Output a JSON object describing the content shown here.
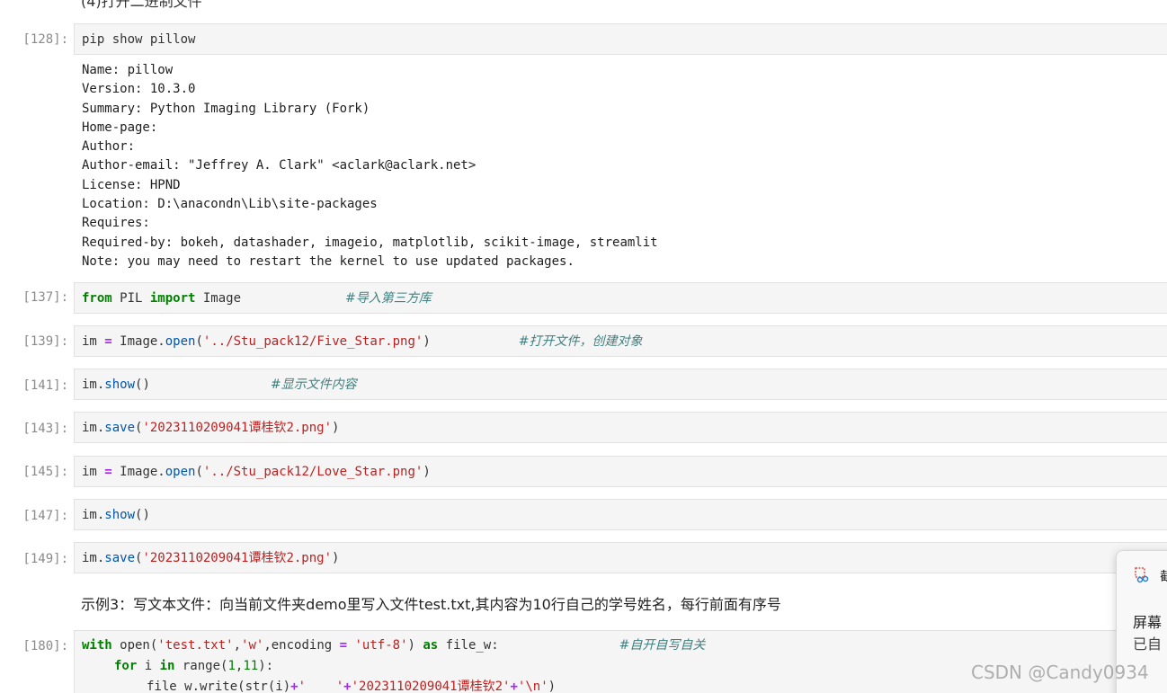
{
  "top_heading": "(4)打开二进制文件",
  "cells": [
    {
      "prompt": "[128]:",
      "code": "pip show pillow"
    },
    {
      "prompt": "[137]:",
      "code_parts": {
        "kw1": "from",
        "mod": " PIL ",
        "kw2": "import",
        "name": " Image",
        "comment": "#导入第三方库"
      }
    },
    {
      "prompt": "[139]:",
      "code_parts": {
        "a": "im ",
        "op": "=",
        "b": " Image.",
        "fn": "open",
        "c": "(",
        "str": "'../Stu_pack12/Five_Star.png'",
        "d": ")",
        "comment": "#打开文件，创建对象"
      }
    },
    {
      "prompt": "[141]:",
      "code_parts": {
        "a": "im.",
        "fn": "show",
        "b": "()",
        "comment": "#显示文件内容"
      }
    },
    {
      "prompt": "[143]:",
      "code_parts": {
        "a": "im.",
        "fn": "save",
        "b": "(",
        "str": "'2023110209041谭桂钦2.png'",
        "c": ")"
      }
    },
    {
      "prompt": "[145]:",
      "code_parts": {
        "a": "im ",
        "op": "=",
        "b": " Image.",
        "fn": "open",
        "c": "(",
        "str": "'../Stu_pack12/Love_Star.png'",
        "d": ")"
      }
    },
    {
      "prompt": "[147]:",
      "code_parts": {
        "a": "im.",
        "fn": "show",
        "b": "()"
      }
    },
    {
      "prompt": "[149]:",
      "code_parts": {
        "a": "im.",
        "fn": "save",
        "b": "(",
        "str": "'2023110209041谭桂钦2.png'",
        "c": ")"
      }
    },
    {
      "prompt": "[180]:",
      "line1": {
        "kw": "with",
        "a": " open(",
        "s1": "'test.txt'",
        "b": ",",
        "s2": "'w'",
        "c": ",encoding ",
        "op": "=",
        "d": " ",
        "s3": "'utf-8'",
        "e": ") ",
        "kw2": "as",
        "f": " file_w:",
        "comment": "#自开自写自关"
      },
      "line2": {
        "kw": "for",
        "a": " i ",
        "op": "in",
        "b": " range(",
        "n1": "1",
        "c": ",",
        "n2": "11",
        "d": "):"
      },
      "line3": {
        "a": "file_w.write(str(i)",
        "op": "+",
        "s1": "'    '",
        "op2": "+",
        "s2": "'2023110209041谭桂钦2'",
        "op3": "+",
        "s3": "'\\n'",
        "b": ")"
      }
    }
  ],
  "output_128": "Name: pillow\nVersion: 10.3.0\nSummary: Python Imaging Library (Fork)\nHome-page:\nAuthor:\nAuthor-email: \"Jeffrey A. Clark\" <aclark@aclark.net>\nLicense: HPND\nLocation: D:\\anacondn\\Lib\\site-packages\nRequires:\nRequired-by: bokeh, datashader, imageio, matplotlib, scikit-image, streamlit\nNote: you may need to restart the kernel to use updated packages.",
  "markdown_example": "示例3：写文本文件：向当前文件夹demo里写入文件test.txt,其内容为10行自己的学号姓名，每行前面有序号",
  "notification": {
    "title": "截",
    "line1": "屏幕",
    "line2": "已自"
  },
  "watermark": "CSDN @Candy0934",
  "colors": {
    "keyword": "#008000",
    "string": "#ba2121",
    "comment": "#408080",
    "operator": "#aa22ff",
    "function": "#0055aa"
  }
}
